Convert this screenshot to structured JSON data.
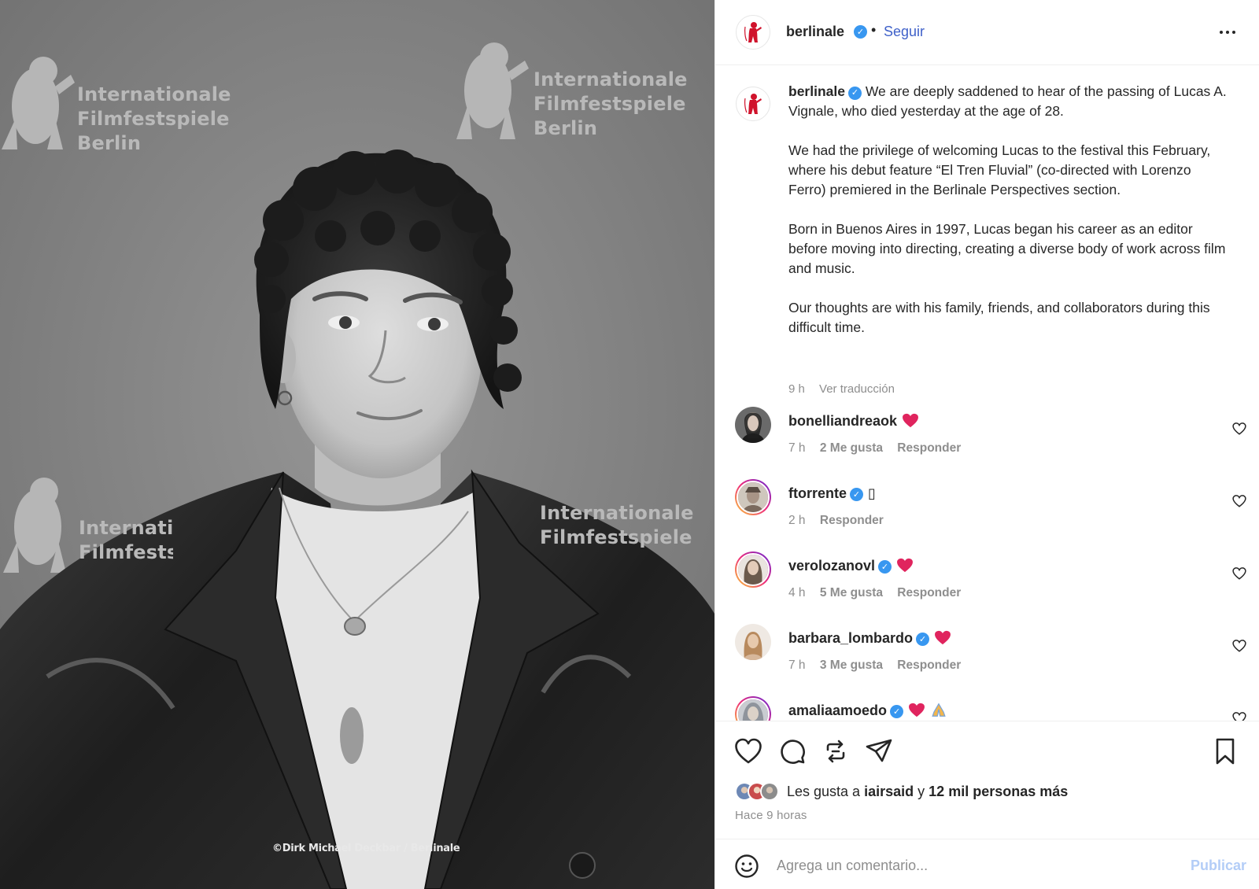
{
  "photo": {
    "backdrop_lines": [
      "Internationale",
      "Filmfestspiele",
      "Berlin"
    ],
    "backdrop_script": "Berlinale",
    "credit": "©Dirk Michael Deckbar / Berlinale"
  },
  "header": {
    "username": "berlinale",
    "separator": "•",
    "follow_label": "Seguir",
    "more_icon": "more-horizontal-icon"
  },
  "caption": {
    "username": "berlinale",
    "paragraphs": [
      "We are deeply saddened to hear of the passing of Lucas A. Vignale, who died yesterday at the age of 28.",
      "We had the privilege of welcoming Lucas to the festival this February, where his debut feature “El Tren Fluvial” (co-directed with Lorenzo Ferro) premiered in the Berlinale Perspectives section.",
      "Born in Buenos Aires in 1997, Lucas began his career as an editor before moving into directing, creating a diverse body of work across film and music.",
      "Our thoughts are with his family, friends, and collaborators during this difficult time."
    ],
    "time": "9 h",
    "translate_label": "Ver traducción"
  },
  "comments": [
    {
      "username": "bonelliandreaok",
      "verified": false,
      "text": "",
      "emoji": "heart",
      "time": "7 h",
      "likes": "2 Me gusta",
      "reply": "Responder"
    },
    {
      "username": "ftorrente",
      "verified": true,
      "text": "▯",
      "emoji": "",
      "time": "2 h",
      "likes": "",
      "reply": "Responder"
    },
    {
      "username": "verolozanovl",
      "verified": true,
      "text": "",
      "emoji": "heart",
      "time": "4 h",
      "likes": "5 Me gusta",
      "reply": "Responder"
    },
    {
      "username": "barbara_lombardo",
      "verified": true,
      "text": "",
      "emoji": "heart",
      "time": "7 h",
      "likes": "3 Me gusta",
      "reply": "Responder"
    },
    {
      "username": "amaliaamoedo",
      "verified": true,
      "text": "",
      "emoji": "heart-pray",
      "time": "",
      "likes": "",
      "reply": ""
    }
  ],
  "actions": {
    "icons": [
      "heart-icon",
      "comment-icon",
      "repost-icon",
      "share-icon",
      "bookmark-icon"
    ],
    "likes_prefix": "Les gusta a",
    "likes_user": "iairsaid",
    "likes_conj": "y",
    "likes_count": "12 mil personas más",
    "post_time": "Hace 9 horas"
  },
  "comment_box": {
    "placeholder": "Agrega un comentario...",
    "publish_label": "Publicar"
  },
  "colors": {
    "verified": "#3897f0",
    "link": "#3f61c9",
    "muted": "#8e8e8e",
    "heart": "#e0245e",
    "publish_disabled": "#b3cdf7"
  }
}
